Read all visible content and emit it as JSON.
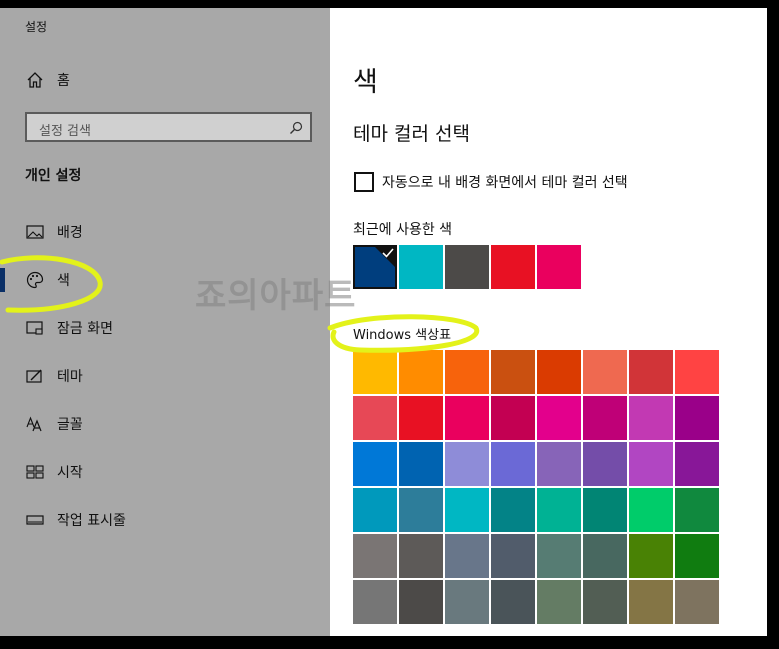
{
  "app": {
    "title": "설정"
  },
  "sidebar": {
    "home_label": "홈",
    "search_placeholder": "설정 검색",
    "section_title": "개인 설정",
    "items": [
      {
        "label": "배경",
        "icon": "picture-icon"
      },
      {
        "label": "색",
        "icon": "palette-icon",
        "active": true
      },
      {
        "label": "잠금 화면",
        "icon": "lock-screen-icon"
      },
      {
        "label": "테마",
        "icon": "theme-icon"
      },
      {
        "label": "글꼴",
        "icon": "font-icon"
      },
      {
        "label": "시작",
        "icon": "start-icon"
      },
      {
        "label": "작업 표시줄",
        "icon": "taskbar-icon"
      }
    ]
  },
  "main": {
    "title": "색",
    "subtitle": "테마 컬러 선택",
    "auto_pick_label": "자동으로 내 배경 화면에서 테마 컬러 선택",
    "auto_pick_checked": false,
    "recent_label": "최근에 사용한 색",
    "recent_colors": [
      "#003e7e",
      "#00b7c3",
      "#4c4a48",
      "#e81123",
      "#ea005e"
    ],
    "recent_selected_index": 0,
    "palette_label": "Windows 색상표",
    "palette": [
      [
        "#ffb900",
        "#ff8c00",
        "#f7630c",
        "#ca5010",
        "#da3b01",
        "#ef6950",
        "#d13438",
        "#ff4343"
      ],
      [
        "#e74856",
        "#e81123",
        "#ea005e",
        "#c30052",
        "#e3008c",
        "#bf0077",
        "#c239b3",
        "#9a0089"
      ],
      [
        "#0078d7",
        "#0063b1",
        "#8e8cd8",
        "#6b69d6",
        "#8764b8",
        "#744da9",
        "#b146c2",
        "#881798"
      ],
      [
        "#0099bc",
        "#2d7d9a",
        "#00b7c3",
        "#038387",
        "#00b294",
        "#018574",
        "#00cc6a",
        "#10893e"
      ],
      [
        "#7a7574",
        "#5d5a58",
        "#68768a",
        "#515c6b",
        "#567c73",
        "#486860",
        "#498205",
        "#107c10"
      ],
      [
        "#767676",
        "#4c4a48",
        "#69797e",
        "#4a5459",
        "#647c64",
        "#525e54",
        "#847545",
        "#7e735f"
      ]
    ]
  },
  "watermark": "죠의아파트",
  "highlight_color": "#e3f21a"
}
